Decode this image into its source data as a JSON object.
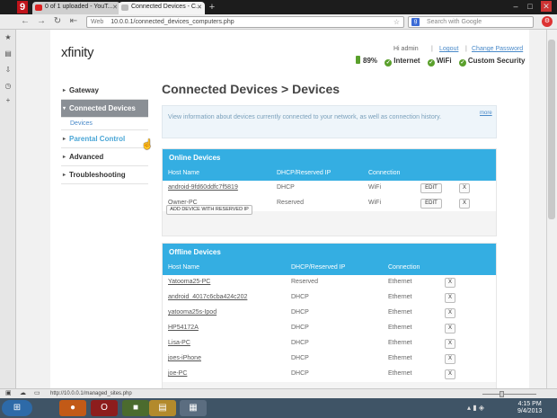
{
  "browser": {
    "tabs": [
      {
        "label": "0 of 1 uploaded - YouT..."
      },
      {
        "label": "Connected Devices - C..."
      }
    ],
    "new_tab": "+",
    "window_controls": {
      "minimize": "–",
      "maximize": "□",
      "close": "✕"
    },
    "address_label": "Web",
    "url": "10.0.0.1/connected_devices_computers.php",
    "search_placeholder": "Search with Google",
    "status_url": "http://10.0.0.1/managed_sites.php"
  },
  "header": {
    "logo": "xfinity",
    "greeting": "Hi admin",
    "separator": "|",
    "logout": "Logout",
    "change_password": "Change Password",
    "battery": "89%",
    "status": [
      "Internet",
      "WiFi",
      "Custom Security"
    ]
  },
  "sidebar": {
    "gateway": "Gateway",
    "connected_devices": "Connected Devices",
    "devices_sub": "Devices",
    "parental_control": "Parental Control",
    "advanced": "Advanced",
    "troubleshooting": "Troubleshooting"
  },
  "main": {
    "title": "Connected Devices > Devices",
    "info": "View information about devices currently connected to your network, as well as connection history.",
    "more": "more",
    "online": {
      "title": "Online Devices",
      "columns": [
        "Host Name",
        "DHCP/Reserved IP",
        "Connection"
      ],
      "rows": [
        {
          "host": "android-9fd60ddfc7f5819",
          "ip": "DHCP",
          "conn": "WiFi",
          "edit": "EDIT",
          "remove": "X"
        },
        {
          "host": "Owner-PC",
          "ip": "Reserved",
          "conn": "WiFi",
          "edit": "EDIT",
          "remove": "X"
        }
      ],
      "add_button": "ADD DEVICE WITH RESERVED IP"
    },
    "offline": {
      "title": "Offline Devices",
      "columns": [
        "Host Name",
        "DHCP/Reserved IP",
        "Connection"
      ],
      "rows": [
        {
          "host": "Yatooma25-PC",
          "ip": "Reserved",
          "conn": "Ethernet",
          "remove": "X"
        },
        {
          "host": "android_4017c6cba424c202",
          "ip": "DHCP",
          "conn": "Ethernet",
          "remove": "X"
        },
        {
          "host": "yatooma25s-Ipod",
          "ip": "DHCP",
          "conn": "Ethernet",
          "remove": "X"
        },
        {
          "host": "HP54172A",
          "ip": "DHCP",
          "conn": "Ethernet",
          "remove": "X"
        },
        {
          "host": "Lisa-PC",
          "ip": "DHCP",
          "conn": "Ethernet",
          "remove": "X"
        },
        {
          "host": "joes-iPhone",
          "ip": "DHCP",
          "conn": "Ethernet",
          "remove": "X"
        },
        {
          "host": "joe-PC",
          "ip": "DHCP",
          "conn": "Ethernet",
          "remove": "X"
        }
      ]
    }
  },
  "taskbar": {
    "time": "4:15 PM",
    "date": "9/4/2013"
  }
}
